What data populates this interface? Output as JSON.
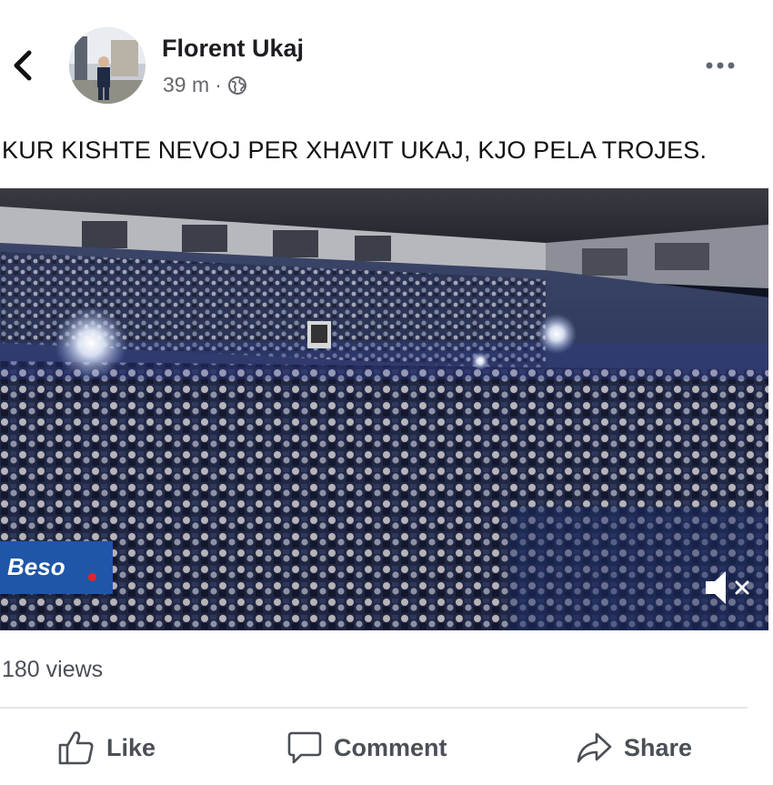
{
  "post": {
    "author": "Florent Ukaj",
    "time": "39 m",
    "separator": "·",
    "caption": "KUR KISHTE NEVOJ PER XHAVIT UKAJ, KJO PELA TROJES."
  },
  "video": {
    "overlay_badge": "Beso",
    "muted": true
  },
  "stats": {
    "views": "180 views"
  },
  "actions": {
    "like": "Like",
    "comment": "Comment",
    "share": "Share"
  },
  "icons": {
    "back": "chevron-left-icon",
    "privacy": "globe-icon",
    "more": "more-horizontal-icon",
    "mute": "speaker-muted-icon",
    "like": "thumbs-up-icon",
    "comment": "speech-bubble-icon",
    "share": "share-arrow-icon"
  },
  "colors": {
    "badge": "#1f56a8",
    "text_secondary": "#65676b"
  }
}
